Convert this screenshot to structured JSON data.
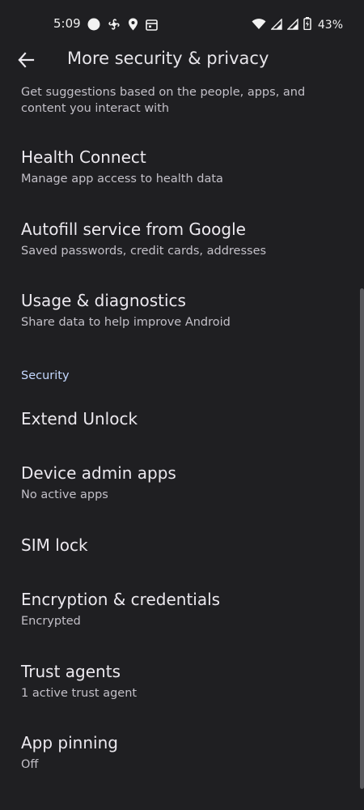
{
  "status_bar": {
    "time": "5:09",
    "battery": "43%",
    "left_icons": [
      "circle-icon",
      "fan-icon",
      "location-icon",
      "calendar-icon"
    ],
    "right_icons": [
      "wifi-icon",
      "signal-icon",
      "signal-icon-2",
      "battery-icon"
    ]
  },
  "header": {
    "title": "More security & privacy"
  },
  "items_top": {
    "partial_summary": "Get suggestions based on the people, apps, and content you interact with"
  },
  "items": [
    {
      "title": "Health Connect",
      "summary": "Manage app access to health data"
    },
    {
      "title": "Autofill service from Google",
      "summary": "Saved passwords, credit cards, addresses"
    },
    {
      "title": "Usage & diagnostics",
      "summary": "Share data to help improve Android"
    }
  ],
  "security": {
    "header": "Security",
    "items": [
      {
        "title": "Extend Unlock",
        "summary": ""
      },
      {
        "title": "Device admin apps",
        "summary": "No active apps"
      },
      {
        "title": "SIM lock",
        "summary": ""
      },
      {
        "title": "Encryption & credentials",
        "summary": "Encrypted"
      },
      {
        "title": "Trust agents",
        "summary": "1 active trust agent"
      },
      {
        "title": "App pinning",
        "summary": "Off"
      }
    ]
  },
  "colors": {
    "background": "#1f1f22",
    "accent": "#c4d8ff",
    "primary_text": "#ece9ef",
    "secondary_text": "#c3c0c8"
  }
}
